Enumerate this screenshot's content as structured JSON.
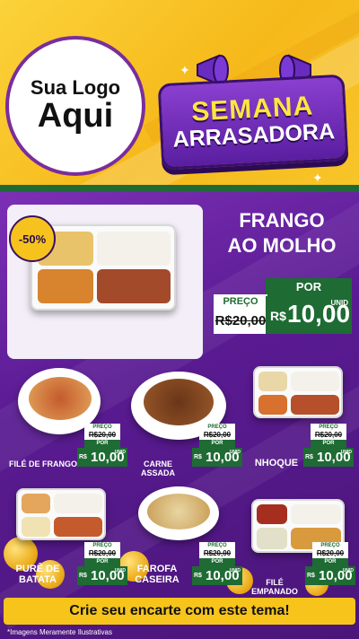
{
  "header": {
    "logo_line1": "Sua Logo",
    "logo_line2": "Aqui",
    "badge_line1": "SEMANA",
    "badge_line2": "ARRASADORA"
  },
  "hero": {
    "discount": "-50%",
    "title_line1": "FRANGO",
    "title_line2": "AO MOLHO",
    "por_label": "POR",
    "preco_label": "PREÇO",
    "old_price": "R$20,00",
    "currency": "R$",
    "new_price": "10,00",
    "unit": "UNID"
  },
  "items": [
    {
      "name": "FILÉ DE FRANGO",
      "preco_label": "PREÇO",
      "old_price": "R$20,00",
      "por_label": "POR",
      "currency": "R$",
      "new_price": "10,00",
      "unit": "UNID"
    },
    {
      "name": "CARNE ASSADA",
      "preco_label": "PREÇO",
      "old_price": "R$20,00",
      "por_label": "POR",
      "currency": "R$",
      "new_price": "10,00",
      "unit": "UNID"
    },
    {
      "name": "NHOQUE",
      "preco_label": "PREÇO",
      "old_price": "R$20,00",
      "por_label": "POR",
      "currency": "R$",
      "new_price": "10,00",
      "unit": "UNID"
    },
    {
      "name_line1": "PURÊ DE",
      "name_line2": "BATATA",
      "preco_label": "PREÇO",
      "old_price": "R$20,00",
      "por_label": "POR",
      "currency": "R$",
      "new_price": "10,00",
      "unit": "UNID"
    },
    {
      "name_line1": "FAROFA",
      "name_line2": "CASEIRA",
      "preco_label": "PREÇO",
      "old_price": "R$20,00",
      "por_label": "POR",
      "currency": "R$",
      "new_price": "10,00",
      "unit": "UNID"
    },
    {
      "name": "FILÉ EMPANADO",
      "preco_label": "PREÇO",
      "old_price": "R$20,00",
      "por_label": "POR",
      "currency": "R$",
      "new_price": "10,00",
      "unit": "UNID"
    }
  ],
  "cta": "Crie seu encarte com este tema!",
  "footnote": "*Imagens Meramente Ilustrativas",
  "colors": {
    "yellow": "#f7c41c",
    "purple": "#5a1b92",
    "green": "#1e6b33"
  }
}
